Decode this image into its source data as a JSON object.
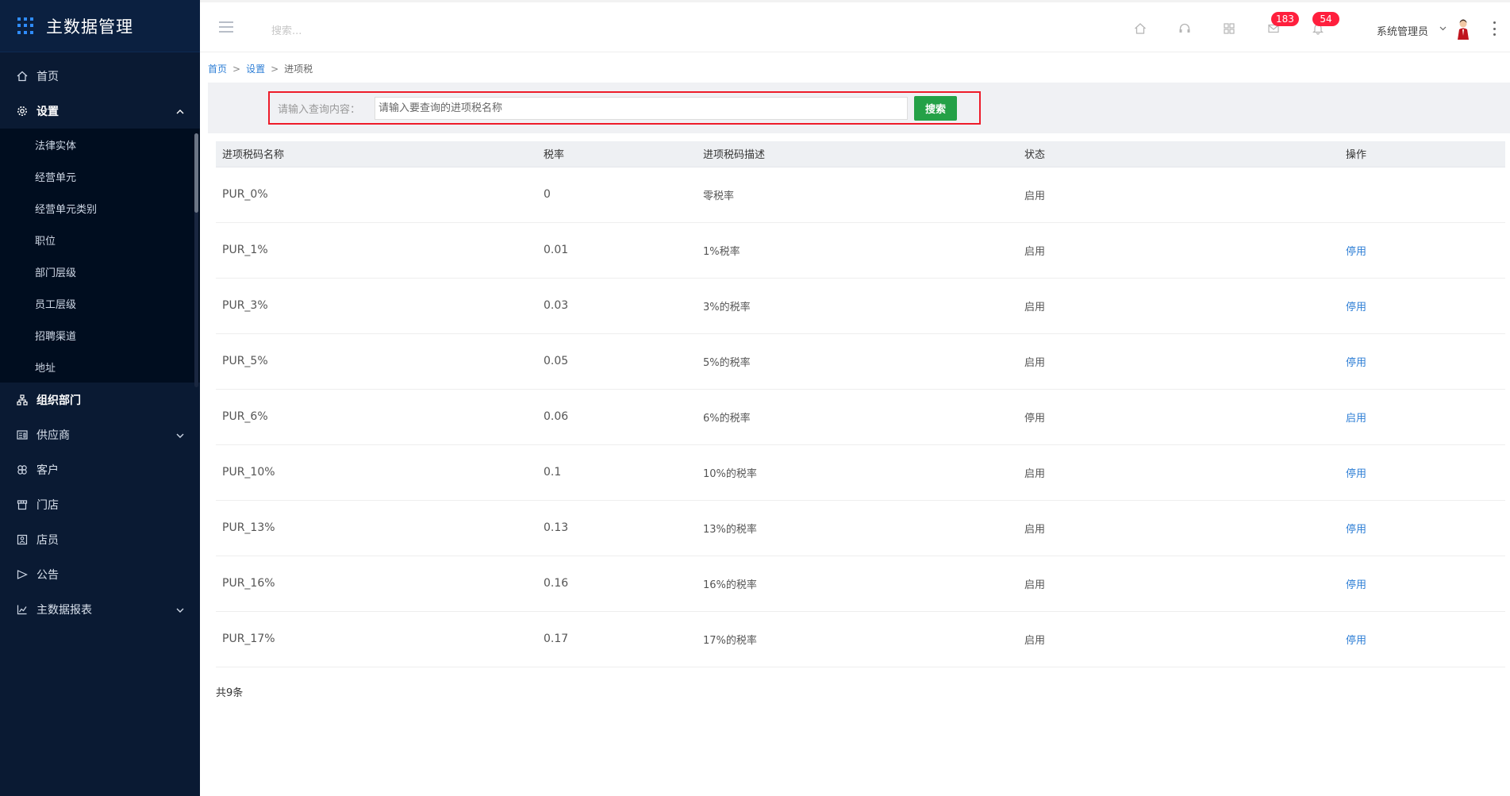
{
  "app": {
    "title": "主数据管理"
  },
  "sidebar": {
    "items": [
      {
        "label": "首页",
        "icon": "home-icon"
      },
      {
        "label": "设置",
        "icon": "gear-icon",
        "expanded": true,
        "children": [
          "法律实体",
          "经营单元",
          "经营单元类别",
          "职位",
          "部门层级",
          "员工层级",
          "招聘渠道",
          "地址"
        ]
      },
      {
        "label": "组织部门",
        "icon": "org-chart-icon"
      },
      {
        "label": "供应商",
        "icon": "supplier-icon",
        "has_arrow": true
      },
      {
        "label": "客户",
        "icon": "customer-icon"
      },
      {
        "label": "门店",
        "icon": "store-icon"
      },
      {
        "label": "店员",
        "icon": "clerk-icon"
      },
      {
        "label": "公告",
        "icon": "announcement-icon"
      },
      {
        "label": "主数据报表",
        "icon": "chart-icon",
        "has_arrow": true
      }
    ]
  },
  "header": {
    "search_placeholder": "搜索...",
    "badge_messages": "183",
    "badge_notifications": "54",
    "user_name": "系统管理员"
  },
  "breadcrumb": {
    "home": "首页",
    "settings": "设置",
    "current": "进项税",
    "separator": ">"
  },
  "search": {
    "label": "请输入查询内容：",
    "placeholder": "请输入要查询的进项税名称",
    "button": "搜索"
  },
  "table": {
    "headers": [
      "进项税码名称",
      "税率",
      "进项税码描述",
      "状态",
      "操作"
    ],
    "rows": [
      {
        "name": "PUR_0%",
        "rate": "0",
        "desc": "零税率",
        "status": "启用",
        "action": ""
      },
      {
        "name": "PUR_1%",
        "rate": "0.01",
        "desc": "1%税率",
        "status": "启用",
        "action": "停用"
      },
      {
        "name": "PUR_3%",
        "rate": "0.03",
        "desc": "3%的税率",
        "status": "启用",
        "action": "停用"
      },
      {
        "name": "PUR_5%",
        "rate": "0.05",
        "desc": "5%的税率",
        "status": "启用",
        "action": "停用"
      },
      {
        "name": "PUR_6%",
        "rate": "0.06",
        "desc": "6%的税率",
        "status": "停用",
        "action": "启用"
      },
      {
        "name": "PUR_10%",
        "rate": "0.1",
        "desc": "10%的税率",
        "status": "启用",
        "action": "停用"
      },
      {
        "name": "PUR_13%",
        "rate": "0.13",
        "desc": "13%的税率",
        "status": "启用",
        "action": "停用"
      },
      {
        "name": "PUR_16%",
        "rate": "0.16",
        "desc": "16%的税率",
        "status": "启用",
        "action": "停用"
      },
      {
        "name": "PUR_17%",
        "rate": "0.17",
        "desc": "17%的税率",
        "status": "启用",
        "action": "停用"
      }
    ]
  },
  "footer": {
    "total": "共9条"
  },
  "colors": {
    "sidebar_bg": "#0a1a33",
    "accent_blue": "#2f7fd6",
    "search_button": "#24a147",
    "badge": "#ff1f3d",
    "highlight_border": "#ee1c2a"
  }
}
